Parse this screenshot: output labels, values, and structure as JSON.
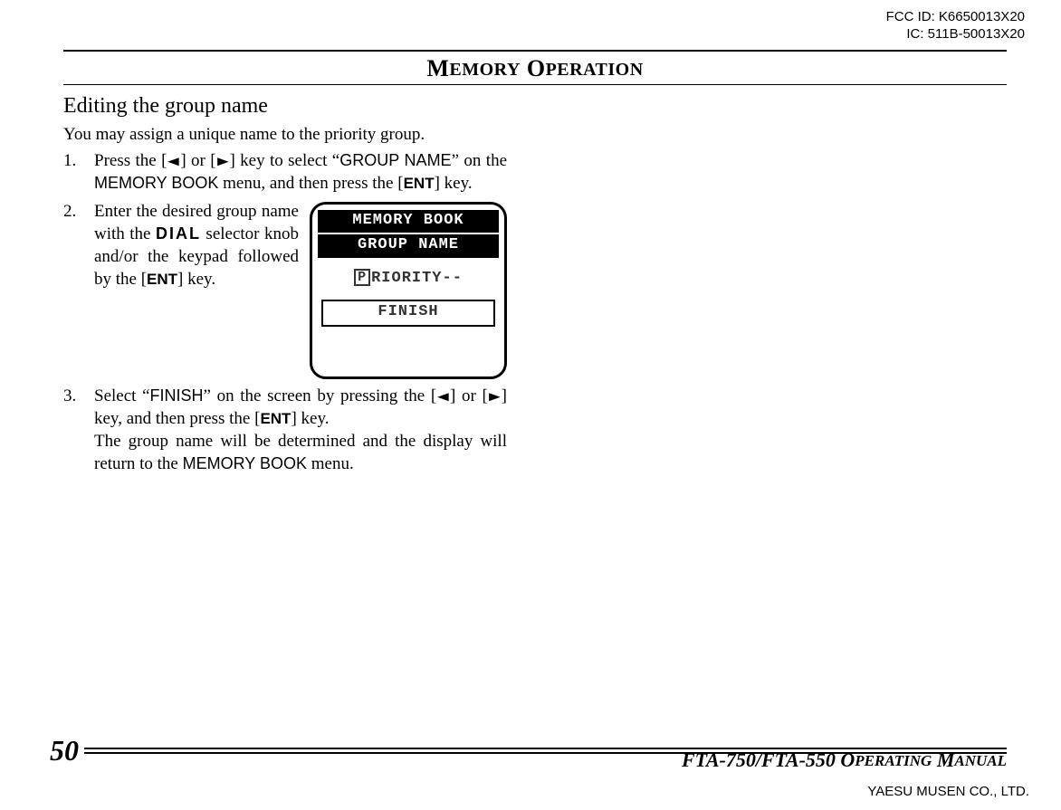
{
  "ids": {
    "fcc": "FCC ID: K6650013X20",
    "ic": "IC: 511B-50013X20"
  },
  "section_title": {
    "big1": "M",
    "small1": "EMORY",
    "big2": "O",
    "small2": "PERATION"
  },
  "subheading": "Editing the group name",
  "intro": "You may assign a unique name to the priority group.",
  "steps": {
    "s1": {
      "num": "1.",
      "p1a": "Press the [",
      "p1b": "] or [",
      "p1c": "] key to select “",
      "ui1": "GROUP NAME",
      "p1d": "” on the ",
      "ui2": "MEMORY BOOK",
      "p1e": " menu, and then press the [",
      "ent": "ENT",
      "p1f": "] key."
    },
    "s2": {
      "num": "2.",
      "p2a": "Enter the desired group name with the ",
      "dial": "DIAL",
      "p2b": " selector knob and/or the keypad followed by the [",
      "ent": "ENT",
      "p2c": "] key."
    },
    "s3": {
      "num": "3.",
      "p3a": "Select “",
      "ui1": "FINISH",
      "p3b": "” on the screen by pressing the [",
      "p3c": "] or [",
      "p3d": "] key, and then press the [",
      "ent": "ENT",
      "p3e": "] key.",
      "p3f": "The group name will be determined and the display will return to the ",
      "ui2": "MEMORY BOOK",
      "p3g": " menu."
    }
  },
  "lcd": {
    "bar1": "MEMORY BOOK",
    "bar2": "GROUP NAME",
    "line_p": "P",
    "line_rest": "RIORITY--",
    "finish": "FINISH"
  },
  "footer": {
    "page": "50",
    "manual_a": "FTA-750/FTA-550 O",
    "manual_b": "PERATING",
    "manual_c": " M",
    "manual_d": "ANUAL",
    "company": "YAESU MUSEN CO., LTD."
  },
  "glyphs": {
    "left": "◄",
    "right": "►"
  }
}
